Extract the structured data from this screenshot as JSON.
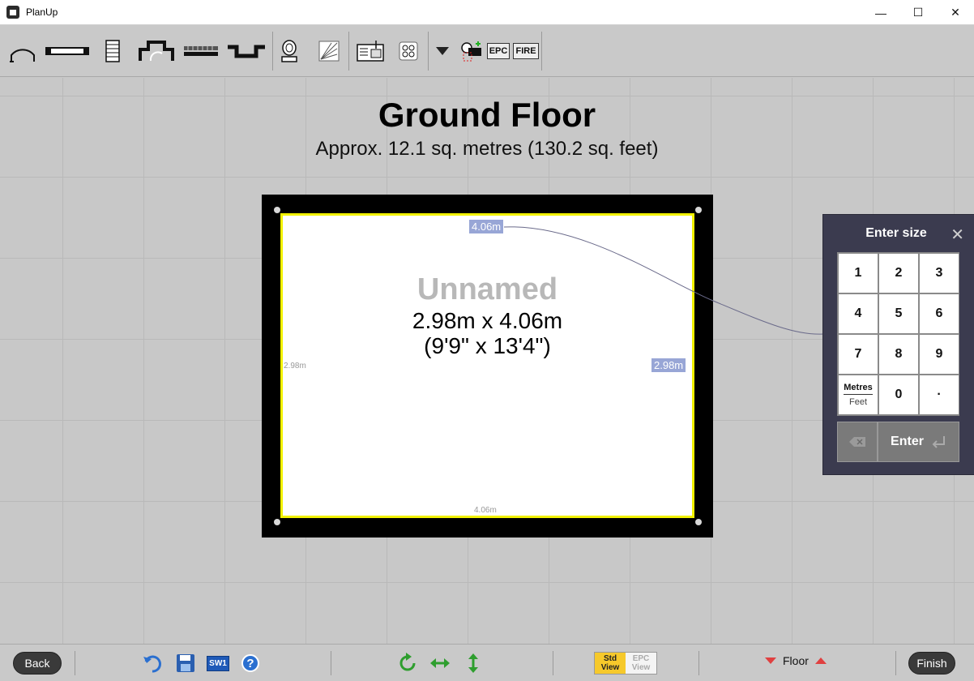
{
  "window": {
    "title": "PlanUp",
    "minimize": "—",
    "maximize": "☐",
    "close": "✕"
  },
  "toolbar": {
    "tools": [
      "door-arc",
      "window",
      "stairs",
      "bay",
      "radiator",
      "alcove",
      "toilet",
      "shading",
      "cupboard",
      "hob",
      "dropdown",
      "camera"
    ],
    "epc_label": "EPC",
    "fire_label": "FIRE"
  },
  "floor": {
    "title": "Ground Floor",
    "area": "Approx. 12.1 sq. metres (130.2 sq. feet)"
  },
  "room": {
    "name": "Unnamed",
    "dims_metric": "2.98m x 4.06m",
    "dims_imperial": "(9'9\" x 13'4\")",
    "top_label": "4.06m",
    "bottom_label": "4.06m",
    "left_label": "2.98m",
    "right_label": "2.98m",
    "highlight_color": "#f2f200"
  },
  "size_panel": {
    "title": "Enter size",
    "close": "✕",
    "keys": [
      "1",
      "2",
      "3",
      "4",
      "5",
      "6",
      "7",
      "8",
      "9"
    ],
    "unit_primary": "Metres",
    "unit_secondary": "Feet",
    "zero": "0",
    "dot": "·",
    "enter_label": "Enter"
  },
  "bottom": {
    "back_label": "Back",
    "sw1_label": "SW1",
    "help_label": "?",
    "std_view": [
      "Std",
      "View"
    ],
    "epc_view": [
      "EPC",
      "View"
    ],
    "floor_label": "Floor",
    "finish_label": "Finish"
  }
}
